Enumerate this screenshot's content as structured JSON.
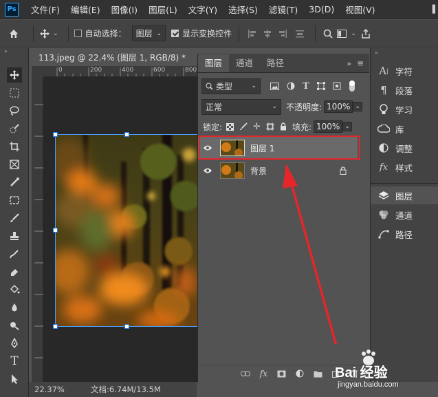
{
  "menubar": {
    "logo": "Ps",
    "items": [
      "文件(F)",
      "编辑(E)",
      "图像(I)",
      "图层(L)",
      "文字(Y)",
      "选择(S)",
      "滤镜(T)",
      "3D(D)",
      "视图(V)"
    ]
  },
  "options": {
    "auto_select_label": "自动选择：",
    "auto_select_target": "图层",
    "show_transform_label": "显示变换控件"
  },
  "document": {
    "tab_title": "113.jpeg @ 22.4% (图层 1, RGB/8) *",
    "close": "×",
    "ruler_ticks": [
      "0",
      "200",
      "400",
      "600",
      "800"
    ],
    "zoom": "22.37%",
    "doc_info": "文档:6.74M/13.5M"
  },
  "layers_panel": {
    "tabs": [
      "图层",
      "通道",
      "路径"
    ],
    "filter_kind": "类型",
    "blend_mode": "正常",
    "opacity_label": "不透明度:",
    "opacity_value": "100%",
    "lock_label": "锁定:",
    "fill_label": "填充:",
    "fill_value": "100%",
    "layers": [
      {
        "name": "图层 1",
        "selected": true,
        "locked": false
      },
      {
        "name": "背景",
        "selected": false,
        "locked": true
      }
    ]
  },
  "dock": {
    "group1": [
      "字符",
      "段落",
      "学习",
      "库",
      "调整",
      "样式"
    ],
    "group2": [
      "图层",
      "通道",
      "路径"
    ]
  },
  "watermark": {
    "brand": "Bai  经验",
    "url": "jingyan.baidu.com"
  },
  "colors": {
    "highlight": "#e5262b",
    "selection": "#4b9cff"
  }
}
